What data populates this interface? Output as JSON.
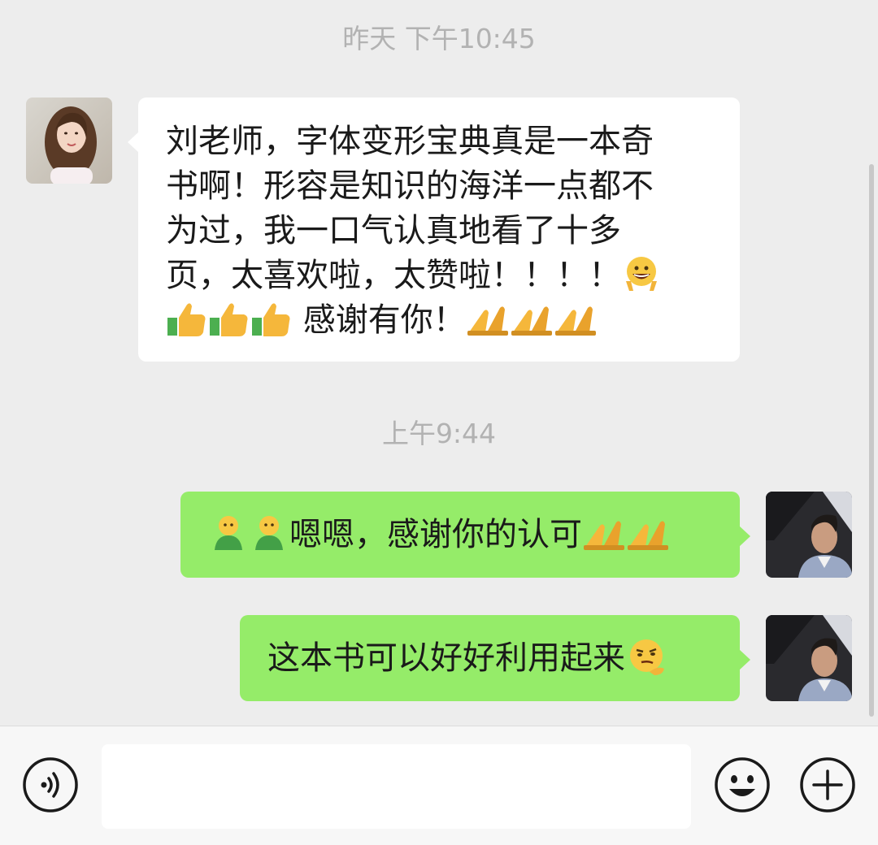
{
  "chat": {
    "time_header_1": "昨天 下午10:45",
    "time_header_2": "上午9:44",
    "messages": [
      {
        "side": "left",
        "lines": [
          "刘老师，字体变形宝典真是一本奇",
          "书啊！形容是知识的海洋一点都不",
          "为过，我一口气认真地看了十多",
          "页，太喜欢啦，太赞啦！！！！",
          " 感谢有你！"
        ],
        "emojis": [
          "grin-peace-emoji",
          "thumbs-up-emoji",
          "pray-emoji"
        ]
      },
      {
        "side": "right",
        "text": "嗯嗯，感谢你的认可",
        "emojis": [
          "green-person-emoji",
          "pray-emoji"
        ]
      },
      {
        "side": "right",
        "text": "这本书可以好好利用起来",
        "emojis": [
          "thinking-smirk-emoji"
        ]
      }
    ]
  },
  "input_bar": {
    "voice_icon": "voice-icon",
    "emoji_icon": "emoji-icon",
    "add_icon": "plus-icon",
    "input_value": ""
  },
  "colors": {
    "background": "#ededed",
    "received_bubble": "#ffffff",
    "sent_bubble": "#95ec69",
    "timestamp": "#b2b2b2",
    "input_bar": "#f7f7f7"
  }
}
